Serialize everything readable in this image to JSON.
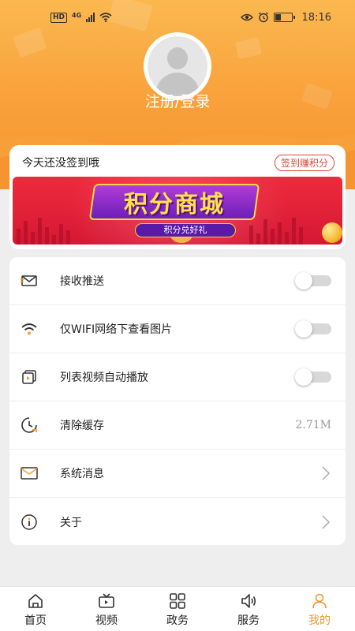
{
  "status_bar": {
    "network": "HD",
    "signal_type": "4G",
    "time": "18:16"
  },
  "profile": {
    "login_label": "注册/登录"
  },
  "signin": {
    "status_text": "今天还没签到哦",
    "button_label": "签到赚积分"
  },
  "banner": {
    "title": "积分商城",
    "subtitle": "积分兑好礼"
  },
  "settings": {
    "items": [
      {
        "label": "接收推送",
        "icon": "envelope-push-icon",
        "control": "toggle",
        "on": false
      },
      {
        "label": "仅WIFI网络下查看图片",
        "icon": "wifi-icon",
        "control": "toggle",
        "on": false
      },
      {
        "label": "列表视频自动播放",
        "icon": "video-play-icon",
        "control": "toggle",
        "on": false
      },
      {
        "label": "清除缓存",
        "icon": "clock-clear-icon",
        "control": "value",
        "value": "2.71M"
      },
      {
        "label": "系统消息",
        "icon": "mail-icon",
        "control": "chevron"
      },
      {
        "label": "关于",
        "icon": "info-icon",
        "control": "chevron"
      }
    ]
  },
  "nav": {
    "items": [
      {
        "label": "首页",
        "icon": "home-icon"
      },
      {
        "label": "视频",
        "icon": "video-icon"
      },
      {
        "label": "政务",
        "icon": "grid-icon"
      },
      {
        "label": "服务",
        "icon": "speaker-icon"
      },
      {
        "label": "我的",
        "icon": "person-icon"
      }
    ],
    "active_index": 4
  },
  "colors": {
    "accent": "#f3952f",
    "header_top": "#fbb84f",
    "signin_red": "#d24a3a"
  }
}
